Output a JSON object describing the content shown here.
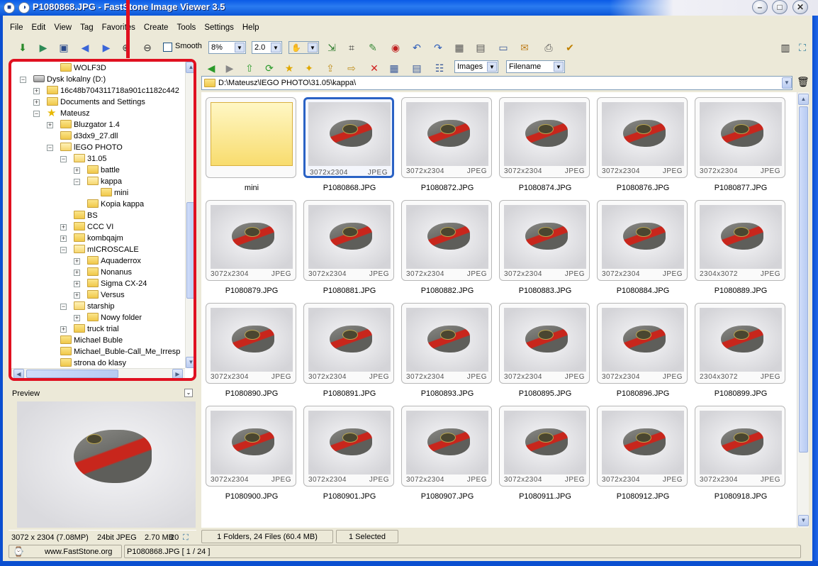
{
  "window": {
    "title": "P1080868.JPG  -  FastStone Image Viewer 3.5"
  },
  "menu": [
    "File",
    "Edit",
    "View",
    "Tag",
    "Favorites",
    "Create",
    "Tools",
    "Settings",
    "Help"
  ],
  "toolbar": {
    "smooth_label": "Smooth",
    "zoom": "8%",
    "ratio": "2.0"
  },
  "tree": [
    {
      "label": "WOLF3D",
      "icon": "folder-icon",
      "depth": 3,
      "exp": ""
    },
    {
      "label": "Dysk lokalny (D:)",
      "icon": "drive-icon",
      "depth": 1,
      "exp": "−"
    },
    {
      "label": "16c48b704311718a901c1182c442",
      "icon": "folder-icon",
      "depth": 2,
      "exp": "+"
    },
    {
      "label": "Documents and Settings",
      "icon": "folder-icon",
      "depth": 2,
      "exp": "+"
    },
    {
      "label": "Mateusz",
      "icon": "star-icon",
      "depth": 2,
      "exp": "−"
    },
    {
      "label": "Bluzgator 1.4",
      "icon": "folder-icon",
      "depth": 3,
      "exp": "+"
    },
    {
      "label": "d3dx9_27.dll",
      "icon": "folder-icon",
      "depth": 3,
      "exp": ""
    },
    {
      "label": "lEGO PHOTO",
      "icon": "folder-open-icon",
      "depth": 3,
      "exp": "−"
    },
    {
      "label": "31.05",
      "icon": "folder-open-icon",
      "depth": 4,
      "exp": "−"
    },
    {
      "label": "battle",
      "icon": "folder-icon",
      "depth": 5,
      "exp": "+"
    },
    {
      "label": "kappa",
      "icon": "folder-open-icon",
      "depth": 5,
      "exp": "−"
    },
    {
      "label": "mini",
      "icon": "folder-icon",
      "depth": 6,
      "exp": ""
    },
    {
      "label": "Kopia kappa",
      "icon": "folder-icon",
      "depth": 5,
      "exp": ""
    },
    {
      "label": "BS",
      "icon": "folder-icon",
      "depth": 4,
      "exp": ""
    },
    {
      "label": "CCC VI",
      "icon": "folder-icon",
      "depth": 4,
      "exp": "+"
    },
    {
      "label": "kombqajm",
      "icon": "folder-icon",
      "depth": 4,
      "exp": "+"
    },
    {
      "label": "mICROSCALE",
      "icon": "folder-open-icon",
      "depth": 4,
      "exp": "−"
    },
    {
      "label": "Aquaderrox",
      "icon": "folder-icon",
      "depth": 5,
      "exp": "+"
    },
    {
      "label": "Nonanus",
      "icon": "folder-icon",
      "depth": 5,
      "exp": "+"
    },
    {
      "label": "Sigma CX-24",
      "icon": "folder-icon",
      "depth": 5,
      "exp": "+"
    },
    {
      "label": "Versus",
      "icon": "folder-icon",
      "depth": 5,
      "exp": "+"
    },
    {
      "label": "starship",
      "icon": "folder-open-icon",
      "depth": 4,
      "exp": "−"
    },
    {
      "label": "Nowy folder",
      "icon": "folder-icon",
      "depth": 5,
      "exp": "+"
    },
    {
      "label": "truck trial",
      "icon": "folder-icon",
      "depth": 4,
      "exp": "+"
    },
    {
      "label": "Michael Buble",
      "icon": "folder-icon",
      "depth": 3,
      "exp": ""
    },
    {
      "label": "Michael_Buble-Call_Me_Irresp",
      "icon": "folder-icon",
      "depth": 3,
      "exp": ""
    },
    {
      "label": "strona do klasy",
      "icon": "folder-icon",
      "depth": 3,
      "exp": ""
    }
  ],
  "preview": {
    "label": "Preview"
  },
  "status_left": {
    "dims": "3072 x 2304 (7.08MP)",
    "type": "24bit JPEG",
    "size": "2.70 MB",
    "zoom": "20"
  },
  "browser": {
    "filter": "Images",
    "sort": "Filename",
    "path": "D:\\Mateusz\\lEGO PHOTO\\31.05\\kappa\\"
  },
  "thumbs": [
    {
      "name": "mini",
      "dims": "",
      "ext": "",
      "folder": true
    },
    {
      "name": "P1080868.JPG",
      "dims": "3072x2304",
      "ext": "JPEG",
      "selected": true
    },
    {
      "name": "P1080872.JPG",
      "dims": "3072x2304",
      "ext": "JPEG"
    },
    {
      "name": "P1080874.JPG",
      "dims": "3072x2304",
      "ext": "JPEG"
    },
    {
      "name": "P1080876.JPG",
      "dims": "3072x2304",
      "ext": "JPEG"
    },
    {
      "name": "P1080877.JPG",
      "dims": "3072x2304",
      "ext": "JPEG"
    },
    {
      "name": "P1080879.JPG",
      "dims": "3072x2304",
      "ext": "JPEG"
    },
    {
      "name": "P1080881.JPG",
      "dims": "3072x2304",
      "ext": "JPEG"
    },
    {
      "name": "P1080882.JPG",
      "dims": "3072x2304",
      "ext": "JPEG"
    },
    {
      "name": "P1080883.JPG",
      "dims": "3072x2304",
      "ext": "JPEG"
    },
    {
      "name": "P1080884.JPG",
      "dims": "3072x2304",
      "ext": "JPEG"
    },
    {
      "name": "P1080889.JPG",
      "dims": "2304x3072",
      "ext": "JPEG"
    },
    {
      "name": "P1080890.JPG",
      "dims": "3072x2304",
      "ext": "JPEG"
    },
    {
      "name": "P1080891.JPG",
      "dims": "3072x2304",
      "ext": "JPEG"
    },
    {
      "name": "P1080893.JPG",
      "dims": "3072x2304",
      "ext": "JPEG"
    },
    {
      "name": "P1080895.JPG",
      "dims": "3072x2304",
      "ext": "JPEG"
    },
    {
      "name": "P1080896.JPG",
      "dims": "3072x2304",
      "ext": "JPEG"
    },
    {
      "name": "P1080899.JPG",
      "dims": "2304x3072",
      "ext": "JPEG"
    },
    {
      "name": "P1080900.JPG",
      "dims": "3072x2304",
      "ext": "JPEG"
    },
    {
      "name": "P1080901.JPG",
      "dims": "3072x2304",
      "ext": "JPEG"
    },
    {
      "name": "P1080907.JPG",
      "dims": "3072x2304",
      "ext": "JPEG"
    },
    {
      "name": "P1080911.JPG",
      "dims": "3072x2304",
      "ext": "JPEG"
    },
    {
      "name": "P1080912.JPG",
      "dims": "3072x2304",
      "ext": "JPEG"
    },
    {
      "name": "P1080918.JPG",
      "dims": "3072x2304",
      "ext": "JPEG"
    }
  ],
  "status_right": {
    "files": "1 Folders, 24 Files (60.4 MB)",
    "selected": "1 Selected"
  },
  "bottom": {
    "site": "www.FastStone.org",
    "current": "P1080868.JPG [ 1 / 24 ]"
  }
}
